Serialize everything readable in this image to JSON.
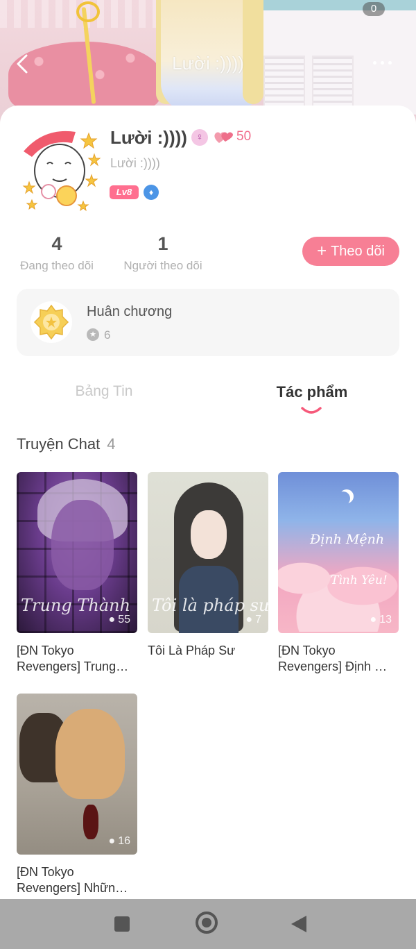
{
  "header": {
    "title": "Lười :))))",
    "count_badge": "0",
    "back_icon": "chevron-left-icon",
    "more_icon": "more-dots-icon"
  },
  "profile": {
    "name": "Lười :))))",
    "subname": "Lười :))))",
    "gender_symbol": "♀",
    "hearts_count": "50",
    "level": "Lv8",
    "verified_symbol": "♦",
    "following_count": "4",
    "following_label": "Đang theo dõi",
    "followers_count": "1",
    "followers_label": "Người theo dõi",
    "follow_button": "Theo dõi",
    "follow_plus": "+"
  },
  "medal": {
    "title": "Huân chương",
    "count": "6",
    "star": "★"
  },
  "tabs": [
    {
      "label": "Bảng Tin",
      "active": false
    },
    {
      "label": "Tác phẩm",
      "active": true
    }
  ],
  "section": {
    "title": "Truyện Chat",
    "count": "4"
  },
  "works": [
    {
      "title": "[ĐN Tokyo Revengers] Trung…",
      "overlay": "Trung Thành",
      "views": "55"
    },
    {
      "title": "Tôi Là Pháp Sư",
      "overlay": "Tôi là pháp sư",
      "views": "7"
    },
    {
      "title": "[ĐN Tokyo Revengers] Định …",
      "overlay_1": "Định Mệnh",
      "overlay_2": "Tình Yêu!",
      "views": "13"
    },
    {
      "title": "[ĐN Tokyo Revengers] Nhữn…",
      "views": "16"
    }
  ],
  "colors": {
    "accent": "#f77f95",
    "level_badge": "#ff6f8f",
    "heart": "#f16d8b",
    "navbar": "#a9a9a9"
  }
}
